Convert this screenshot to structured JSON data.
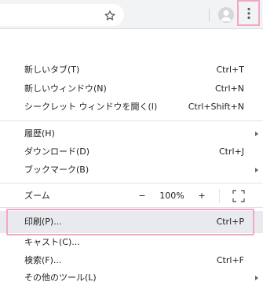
{
  "menu": {
    "new_tab": {
      "label": "新しいタブ(T)",
      "shortcut": "Ctrl+T"
    },
    "new_window": {
      "label": "新しいウィンドウ(N)",
      "shortcut": "Ctrl+N"
    },
    "incognito": {
      "label": "シークレット ウィンドウを開く(I)",
      "shortcut": "Ctrl+Shift+N"
    },
    "history": {
      "label": "履歴(H)"
    },
    "downloads": {
      "label": "ダウンロード(D)",
      "shortcut": "Ctrl+J"
    },
    "bookmarks": {
      "label": "ブックマーク(B)"
    },
    "zoom": {
      "label": "ズーム",
      "minus": "−",
      "value": "100%",
      "plus": "+"
    },
    "print": {
      "label": "印刷(P)...",
      "shortcut": "Ctrl+P"
    },
    "cast": {
      "label": "キャスト(C)..."
    },
    "find": {
      "label": "検索(F)...",
      "shortcut": "Ctrl+F"
    },
    "more_tools": {
      "label": "その他のツール(L)"
    }
  },
  "icons": {
    "star": "star-icon",
    "avatar": "avatar-icon",
    "kebab": "more-vert-icon",
    "fullscreen": "fullscreen-icon",
    "submenu_arrow": "chevron-right-icon"
  },
  "colors": {
    "highlight": "#f2a7c7",
    "hover_row": "#e8eaed",
    "toolbar": "#f1f3f4"
  }
}
